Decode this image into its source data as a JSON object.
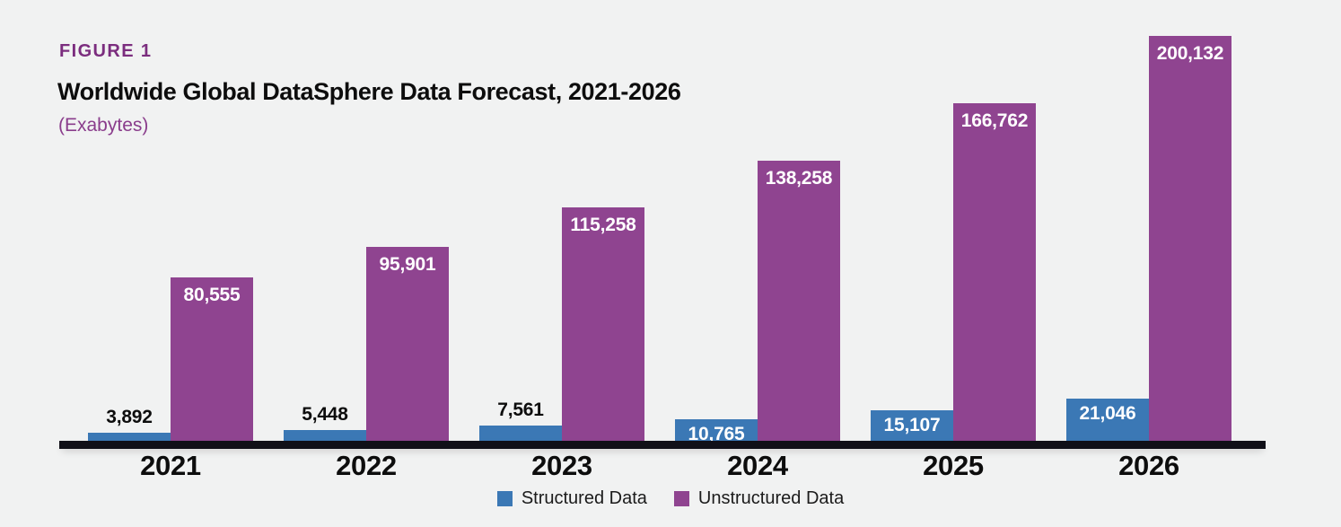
{
  "figure": {
    "label": "FIGURE 1",
    "title": "Worldwide Global DataSphere Data Forecast, 2021-2026",
    "subtitle": "(Exabytes)"
  },
  "colors": {
    "background": "#f1f2f2",
    "structured": "#3b78b5",
    "unstructured": "#8f4490",
    "accent_purple": "#7b2d7e",
    "subtitle_purple": "#8a3d8c",
    "axis": "#101018",
    "label_dark": "#0d0d0d",
    "label_light": "#ffffff"
  },
  "legend": {
    "position": "bottom-center",
    "items": [
      {
        "label": "Structured Data",
        "color": "#3b78b5",
        "swatch": "square-swatch"
      },
      {
        "label": "Unstructured Data",
        "color": "#8f4490",
        "swatch": "square-swatch"
      }
    ]
  },
  "chart_data": {
    "type": "bar",
    "title": "Worldwide Global DataSphere Data Forecast, 2021-2026",
    "subtitle": "(Exabytes)",
    "xlabel": "",
    "ylabel": "Exabytes",
    "ylim": [
      0,
      200132
    ],
    "grid": false,
    "legend_position": "bottom-center",
    "categories": [
      "2021",
      "2022",
      "2023",
      "2024",
      "2025",
      "2026"
    ],
    "series": [
      {
        "name": "Structured Data",
        "color": "#3b78b5",
        "values": [
          3892,
          5448,
          7561,
          10765,
          15107,
          21046
        ],
        "value_labels": [
          "3,892",
          "5,448",
          "7,561",
          "10,765",
          "15,107",
          "21,046"
        ],
        "label_placement": [
          "outside",
          "outside",
          "outside",
          "inside",
          "inside",
          "inside"
        ]
      },
      {
        "name": "Unstructured Data",
        "color": "#8f4490",
        "values": [
          80555,
          95901,
          115258,
          138258,
          166762,
          200132
        ],
        "value_labels": [
          "80,555",
          "95,901",
          "115,258",
          "138,258",
          "166,762",
          "200,132"
        ],
        "label_placement": [
          "inside",
          "inside",
          "inside",
          "inside",
          "inside",
          "inside"
        ]
      }
    ]
  }
}
